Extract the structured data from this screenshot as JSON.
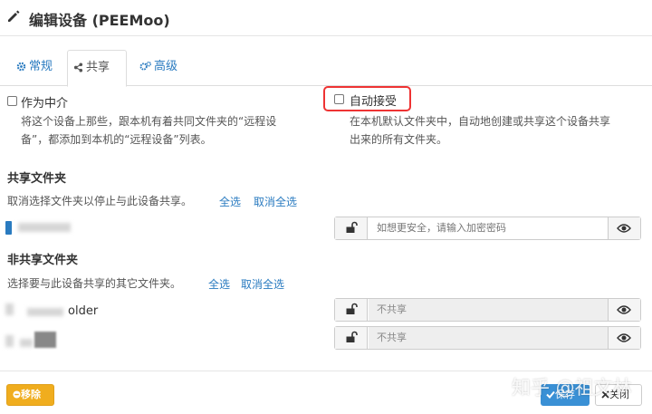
{
  "dialog": {
    "title": "编辑设备 (PEEMoo)"
  },
  "tabs": [
    {
      "label": "常规",
      "icon": "gear-icon"
    },
    {
      "label": "共享",
      "icon": "share-icon"
    },
    {
      "label": "高级",
      "icon": "cogs-icon"
    }
  ],
  "introducer": {
    "label": "作为中介",
    "help_line1": "将这个设备上那些，跟本机有着共同文件夹的“远程设",
    "help_line2": "备”，都添加到本机的“远程设备”列表。",
    "checked": false
  },
  "auto_accept": {
    "label": "自动接受",
    "help_line1": "在本机默认文件夹中，自动地创建或共享这个设备共享",
    "help_line2": "出来的所有文件夹。",
    "checked": false
  },
  "shared": {
    "title": "共享文件夹",
    "desc": "取消选择文件夹以停止与此设备共享。",
    "select_all": "全选",
    "deselect_all": "取消全选",
    "folders": [
      {
        "password_placeholder": "如想更安全，请输入加密密码"
      }
    ]
  },
  "unshared": {
    "title": "非共享文件夹",
    "desc": "选择要与此设备共享的其它文件夹。",
    "select_all": "全选",
    "deselect_all": "取消全选",
    "folders": [
      {
        "name": "older",
        "status": "不共享"
      },
      {
        "name": "",
        "status": "不共享"
      }
    ]
  },
  "footer": {
    "remove_label": "移除",
    "save_label": "保存",
    "close_label": "关闭"
  },
  "watermark": "知乎 @祖文林",
  "colors": {
    "link": "#2a7bc0",
    "remove": "#f0ad1e",
    "save": "#3a90d5",
    "highlight": "#e33"
  }
}
